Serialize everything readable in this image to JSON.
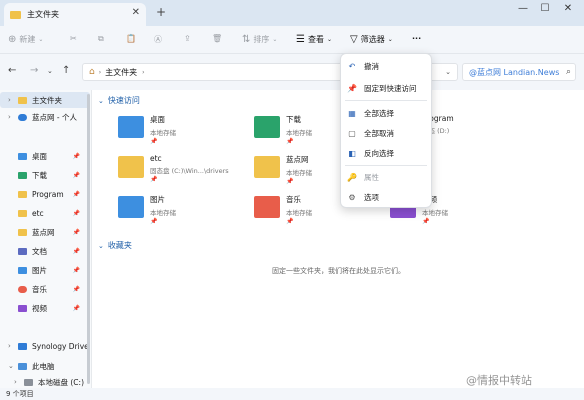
{
  "window": {
    "tab_title": "主文件夹",
    "new_tab": "+",
    "minimize": "—",
    "maximize": "☐",
    "close": "✕"
  },
  "toolbar": {
    "new_label": "新建",
    "sort_label": "排序",
    "view_label": "查看",
    "filter_label": "筛选器",
    "more_label": "···"
  },
  "address": {
    "path": "主文件夹",
    "search_watermark": "@蓝点网 Landian.News"
  },
  "sidebar": {
    "items": [
      {
        "label": "主文件夹",
        "chev": "›",
        "color": "#f0c24b"
      },
      {
        "label": "蓝点网 - 个人",
        "chev": "›",
        "color": "#2f7cd6"
      },
      {
        "label": "桌面",
        "color": "#3d8fe0"
      },
      {
        "label": "下载",
        "color": "#2aa36b"
      },
      {
        "label": "Program",
        "color": "#f0c24b"
      },
      {
        "label": "etc",
        "color": "#f0c24b"
      },
      {
        "label": "蓝点网",
        "color": "#f0c24b"
      },
      {
        "label": "文档",
        "color": "#5c6bc0"
      },
      {
        "label": "图片",
        "color": "#3d8fe0"
      },
      {
        "label": "音乐",
        "color": "#e85d4a"
      },
      {
        "label": "视频",
        "color": "#8a4fd0"
      },
      {
        "label": "Synology Drive",
        "chev": "›",
        "color": "#2f7cd6"
      },
      {
        "label": "此电脑",
        "chev": "⌄",
        "color": "#4a90d9"
      },
      {
        "label": "本地磁盘 (C:)",
        "chev": "›",
        "color": "#8a9099"
      }
    ]
  },
  "main": {
    "quick_access_title": "快速访问",
    "favorites_title": "收藏夹",
    "empty_message": "固定一些文件夹，我们将在此处显示它们。",
    "items": [
      {
        "title": "桌面",
        "sub": "本地存储",
        "color": "#3d8fe0"
      },
      {
        "title": "下载",
        "sub": "本地存储",
        "color": "#2aa36b"
      },
      {
        "title": "Program",
        "sub": "固态 (D:)",
        "color": "#f0c24b"
      },
      {
        "title": "etc",
        "sub": "固态盘 (C:)\\Win...\\drivers",
        "color": "#f0c24b"
      },
      {
        "title": "蓝点网",
        "sub": "本地存储",
        "color": "#f0c24b"
      },
      {
        "title": "图片",
        "sub": "本地存储",
        "color": "#3d8fe0"
      },
      {
        "title": "音乐",
        "sub": "本地存储",
        "color": "#e85d4a"
      },
      {
        "title": "视频",
        "sub": "本地存储",
        "color": "#8a4fd0"
      }
    ]
  },
  "menu": {
    "undo": "撤消",
    "pin_quick": "固定到快速访问",
    "select_all": "全部选择",
    "select_none": "全部取消",
    "invert": "反向选择",
    "properties": "属性",
    "options": "选项"
  },
  "status": {
    "count": "9 个项目",
    "watermark": "@情报中转站"
  }
}
